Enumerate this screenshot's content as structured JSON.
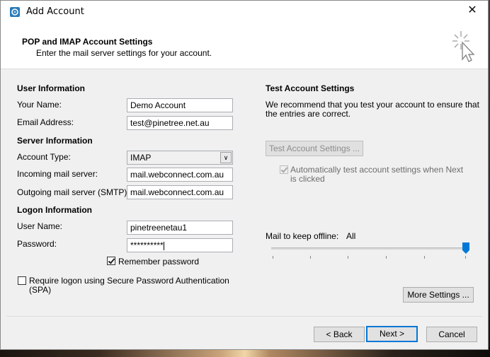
{
  "window": {
    "title": "Add Account",
    "close_glyph": "✕"
  },
  "header": {
    "title": "POP and IMAP Account Settings",
    "subtitle": "Enter the mail server settings for your account."
  },
  "user_info": {
    "heading": "User Information",
    "name_label": "Your Name:",
    "name_value": "Demo Account",
    "email_label": "Email Address:",
    "email_value": "test@pinetree.net.au"
  },
  "server_info": {
    "heading": "Server Information",
    "account_type_label": "Account Type:",
    "account_type_value": "IMAP",
    "incoming_label": "Incoming mail server:",
    "incoming_value": "mail.webconnect.com.au",
    "outgoing_label": "Outgoing mail server (SMTP):",
    "outgoing_value": "mail.webconnect.com.au"
  },
  "logon_info": {
    "heading": "Logon Information",
    "username_label": "User Name:",
    "username_value": "pinetreenetau1",
    "password_label": "Password:",
    "password_value": "**********",
    "remember_label": "Remember password",
    "remember_checked": true,
    "spa_label_line1": "Require logon using Secure Password Authentication",
    "spa_label_line2": "(SPA)",
    "spa_checked": false
  },
  "test_settings": {
    "heading": "Test Account Settings",
    "description_line1": "We recommend that you test your account to ensure that",
    "description_line2": "the entries are correct.",
    "test_button": "Test Account Settings ...",
    "auto_test_line1": "Automatically test account settings when Next",
    "auto_test_line2": "is clicked",
    "auto_test_checked": true
  },
  "offline": {
    "label": "Mail to keep offline:",
    "value": "All",
    "level_percent": 100
  },
  "buttons": {
    "more_settings": "More Settings ...",
    "back": "< Back",
    "next": "Next >",
    "cancel": "Cancel"
  },
  "colors": {
    "accent": "#0078d7",
    "window_bg": "#f0f0f0"
  }
}
